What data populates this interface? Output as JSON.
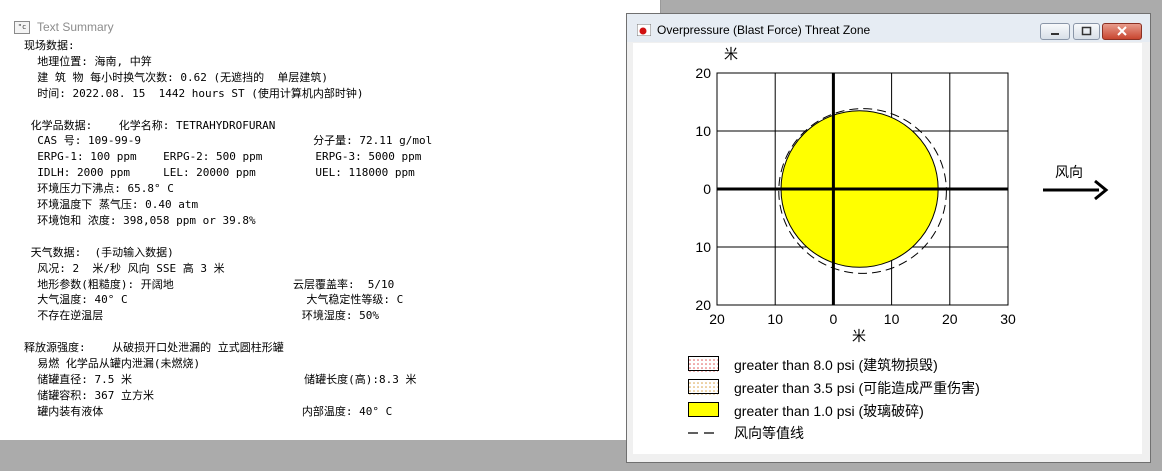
{
  "summary_window": {
    "title": "Text Summary",
    "icon": "doc-window-icon",
    "lines": [
      "现场数据:",
      "  地理位置: 海南, 中笄",
      "  建 筑 物 每小时换气次数: 0.62 (无遮挡的  单层建筑)",
      "  时间: 2022.08. 15  1442 hours ST (使用计算机内部时钟)",
      "",
      " 化学品数据:    化学名称: TETRAHYDROFURAN",
      "  CAS 号: 109-99-9                          分子量: 72.11 g/mol",
      "  ERPG-1: 100 ppm    ERPG-2: 500 ppm        ERPG-3: 5000 ppm",
      "  IDLH: 2000 ppm     LEL: 20000 ppm         UEL: 118000 ppm",
      "  环境压力下沸点: 65.8° C",
      "  环境温度下 蒸气压: 0.40 atm",
      "  环境饱和 浓度: 398,058 ppm or 39.8%",
      "",
      " 天气数据:  (手动输入数据)",
      "  风况: 2  米/秒 风向 SSE 高 3 米",
      "  地形参数(粗糙度): 开阔地                  云层覆盖率:  5/10",
      "  大气温度: 40° C                           大气稳定性等级: C",
      "  不存在逆温层                              环境湿度: 50%",
      "",
      "释放源强度:    从破损开口处泄漏的 立式圆柱形罐",
      "  易燃 化学品从罐内泄漏(未燃烧)",
      "  储罐直径: 7.5 米                          储罐长度(高):8.3 米",
      "  储罐容积: 367 立方米",
      "  罐内装有液体                              内部温度: 40° C"
    ]
  },
  "threat_window": {
    "title": "Overpressure (Blast Force) Threat Zone",
    "icon": "aloha-app-icon",
    "buttons": {
      "minimize": "minimize-icon",
      "maximize": "maximize-icon",
      "close": "close-icon"
    },
    "wind_label": "风向",
    "legend": [
      {
        "label": "greater than 8.0 psi (建筑物损毁)",
        "color": "#ffffff",
        "pattern": "red-dots"
      },
      {
        "label": "greater than 3.5 psi (可能造成严重伤害)",
        "color": "#ffffff",
        "pattern": "orange-dots"
      },
      {
        "label": "greater than 1.0 psi (玻璃破碎)",
        "color": "#ffff00",
        "pattern": "solid"
      },
      {
        "label": "风向等值线",
        "color": "#000000",
        "pattern": "dash"
      }
    ]
  },
  "chart_data": {
    "type": "scatter",
    "xlabel": "米",
    "ylabel": "米",
    "xlim": [
      -20,
      30
    ],
    "ylim": [
      -20,
      20
    ],
    "x_ticks": [
      -20,
      -10,
      0,
      10,
      20,
      30
    ],
    "x_tick_labels": [
      "20",
      "10",
      "0",
      "10",
      "20",
      "30"
    ],
    "y_ticks": [
      20,
      10,
      0,
      -10,
      -20
    ],
    "y_tick_labels": [
      "20",
      "10",
      "0",
      "10",
      "20"
    ],
    "grid": true,
    "zones": [
      {
        "name": "greater than 1.0 psi (玻璃破碎)",
        "center": [
          4.5,
          0
        ],
        "radius": 13.5,
        "color": "#ffff00"
      }
    ],
    "confidence_lines": [
      {
        "name": "风向等值线",
        "center": [
          4.5,
          0
        ],
        "rx": 14.4,
        "ry": 14.2,
        "style": "dashed"
      }
    ]
  }
}
